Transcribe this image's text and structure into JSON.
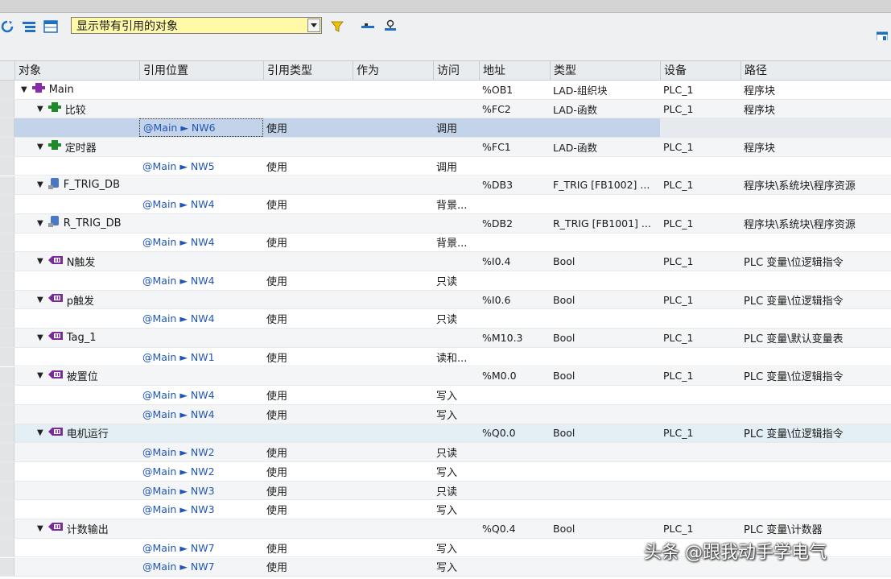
{
  "toolbar": {
    "filter_value": "显示带有引用的对象"
  },
  "columns": [
    "对象",
    "引用位置",
    "引用类型",
    "作为",
    "访问",
    "地址",
    "类型",
    "设备",
    "路径"
  ],
  "rows": [
    {
      "kind": "obj",
      "indent": 1,
      "icon": "ob",
      "name": "Main",
      "addr": "%OB1",
      "type": "LAD-组织块",
      "device": "PLC_1",
      "path": "程序块"
    },
    {
      "kind": "obj",
      "indent": 2,
      "icon": "fc",
      "name": "比较",
      "addr": "%FC2",
      "type": "LAD-函数",
      "device": "PLC_1",
      "path": "程序块"
    },
    {
      "kind": "ref",
      "ref": "@Main ► NW6",
      "rtype": "使用",
      "access": "调用",
      "selected": true
    },
    {
      "kind": "obj",
      "indent": 2,
      "icon": "fc",
      "name": "定时器",
      "addr": "%FC1",
      "type": "LAD-函数",
      "device": "PLC_1",
      "path": "程序块"
    },
    {
      "kind": "ref",
      "ref": "@Main ► NW5",
      "rtype": "使用",
      "access": "调用"
    },
    {
      "kind": "obj",
      "indent": 2,
      "icon": "db",
      "name": "F_TRIG_DB",
      "addr": "%DB3",
      "type": "F_TRIG [FB1002] ...",
      "device": "PLC_1",
      "path": "程序块\\系统块\\程序资源"
    },
    {
      "kind": "ref",
      "ref": "@Main ► NW4",
      "rtype": "使用",
      "access": "背景..."
    },
    {
      "kind": "obj",
      "indent": 2,
      "icon": "db",
      "name": "R_TRIG_DB",
      "addr": "%DB2",
      "type": "R_TRIG [FB1001] ...",
      "device": "PLC_1",
      "path": "程序块\\系统块\\程序资源"
    },
    {
      "kind": "ref",
      "ref": "@Main ► NW4",
      "rtype": "使用",
      "access": "背景..."
    },
    {
      "kind": "obj",
      "indent": 2,
      "icon": "tag",
      "name": "N触发",
      "addr": "%I0.4",
      "type": "Bool",
      "device": "PLC_1",
      "path": "PLC 变量\\位逻辑指令"
    },
    {
      "kind": "ref",
      "ref": "@Main ► NW4",
      "rtype": "使用",
      "access": "只读"
    },
    {
      "kind": "obj",
      "indent": 2,
      "icon": "tag",
      "name": "p触发",
      "addr": "%I0.6",
      "type": "Bool",
      "device": "PLC_1",
      "path": "PLC 变量\\位逻辑指令"
    },
    {
      "kind": "ref",
      "ref": "@Main ► NW4",
      "rtype": "使用",
      "access": "只读"
    },
    {
      "kind": "obj",
      "indent": 2,
      "icon": "tag",
      "name": "Tag_1",
      "addr": "%M10.3",
      "type": "Bool",
      "device": "PLC_1",
      "path": "PLC 变量\\默认变量表"
    },
    {
      "kind": "ref",
      "ref": "@Main ► NW1",
      "rtype": "使用",
      "access": "读和..."
    },
    {
      "kind": "obj",
      "indent": 2,
      "icon": "tag",
      "name": "被置位",
      "addr": "%M0.0",
      "type": "Bool",
      "device": "PLC_1",
      "path": "PLC 变量\\位逻辑指令"
    },
    {
      "kind": "ref",
      "ref": "@Main ► NW4",
      "rtype": "使用",
      "access": "写入"
    },
    {
      "kind": "ref",
      "ref": "@Main ► NW4",
      "rtype": "使用",
      "access": "写入"
    },
    {
      "kind": "obj",
      "indent": 2,
      "icon": "tag",
      "name": "电机运行",
      "addr": "%Q0.0",
      "type": "Bool",
      "device": "PLC_1",
      "path": "PLC 变量\\位逻辑指令",
      "highlight": true
    },
    {
      "kind": "ref",
      "ref": "@Main ► NW2",
      "rtype": "使用",
      "access": "只读"
    },
    {
      "kind": "ref",
      "ref": "@Main ► NW2",
      "rtype": "使用",
      "access": "写入"
    },
    {
      "kind": "ref",
      "ref": "@Main ► NW3",
      "rtype": "使用",
      "access": "只读"
    },
    {
      "kind": "ref",
      "ref": "@Main ► NW3",
      "rtype": "使用",
      "access": "写入"
    },
    {
      "kind": "obj",
      "indent": 2,
      "icon": "tag",
      "name": "计数输出",
      "addr": "%Q0.4",
      "type": "Bool",
      "device": "PLC_1",
      "path": "PLC 变量\\计数器"
    },
    {
      "kind": "ref",
      "ref": "@Main ► NW7",
      "rtype": "使用",
      "access": "写入"
    },
    {
      "kind": "ref",
      "ref": "@Main ► NW7",
      "rtype": "使用",
      "access": "写入"
    }
  ],
  "watermark": "头条 @跟我动手学电气"
}
